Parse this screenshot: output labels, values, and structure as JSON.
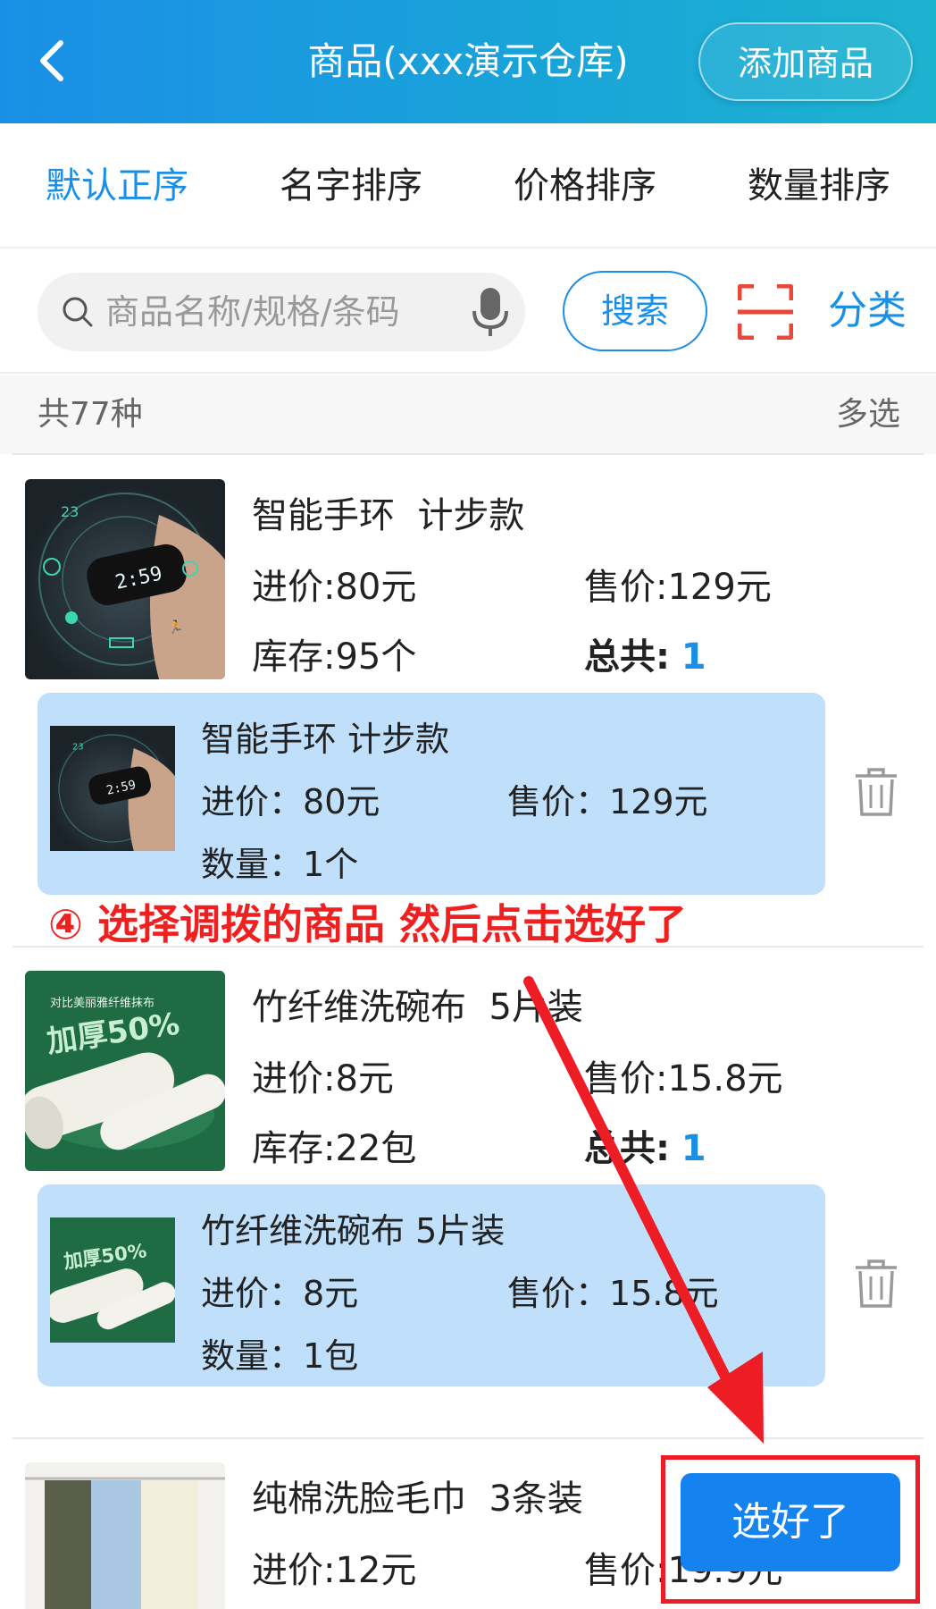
{
  "header": {
    "title": "商品(xxx演示仓库)",
    "add_button": "添加商品",
    "back_icon": "chevron-left-icon"
  },
  "sort_tabs": [
    {
      "label": "默认正序",
      "active": true
    },
    {
      "label": "名字排序",
      "active": false
    },
    {
      "label": "价格排序",
      "active": false
    },
    {
      "label": "数量排序",
      "active": false
    }
  ],
  "search": {
    "placeholder": "商品名称/规格/条码",
    "search_button": "搜索",
    "category_label": "分类",
    "search_icon": "search-icon",
    "mic_icon": "microphone-icon",
    "scan_icon": "scan-icon"
  },
  "list": {
    "count": "共77种",
    "multi_select": "多选"
  },
  "products": [
    {
      "name": "智能手环",
      "spec": "计步款",
      "purchase_label": "进价:",
      "purchase": "80元",
      "sale_label": "售价:",
      "sale": "129元",
      "stock_label": "库存:",
      "stock": "95个",
      "total_label": "总共:",
      "total": "1",
      "selected": {
        "name": "智能手环 计步款",
        "purchase_label": "进价：",
        "purchase": "80元",
        "sale_label": "售价：",
        "sale": "129元",
        "qty_label": "数量：",
        "qty": "1个"
      }
    },
    {
      "name": "竹纤维洗碗布",
      "spec": "5片装",
      "purchase_label": "进价:",
      "purchase": "8元",
      "sale_label": "售价:",
      "sale": "15.8元",
      "stock_label": "库存:",
      "stock": "22包",
      "total_label": "总共:",
      "total": "1",
      "thumb_text": "加厚50%",
      "thumb_caption": "对比美丽雅纤维抹布",
      "selected": {
        "name": "竹纤维洗碗布 5片装",
        "purchase_label": "进价：",
        "purchase": "8元",
        "sale_label": "售价：",
        "sale": "15.8元",
        "qty_label": "数量：",
        "qty": "1包"
      }
    },
    {
      "name": "纯棉洗脸毛巾",
      "spec": "3条装",
      "purchase_label": "进价:",
      "purchase": "12元",
      "sale_label": "售价:",
      "sale": "19.9元"
    }
  ],
  "annotation": "④ 选择调拨的商品 然后点击选好了",
  "done_button": "选好了",
  "colors": {
    "accent": "#1a8fe6",
    "header_gradient_start": "#1a8fe6",
    "header_gradient_end": "#1cb3cf",
    "selected_card": "#bfdffa",
    "annotation_red": "#ef2020"
  }
}
